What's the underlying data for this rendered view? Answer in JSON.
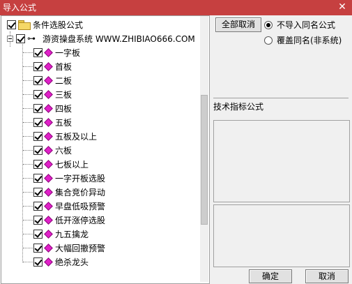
{
  "window": {
    "title": "导入公式",
    "close_glyph": "✕"
  },
  "tree": {
    "root": {
      "label": "条件选股公式",
      "checked": true
    },
    "group": {
      "label": "游资操盘系统 WWW.ZHIBIAO666.COM",
      "checked": true
    },
    "items": [
      {
        "label": "一字板",
        "checked": true
      },
      {
        "label": "首板",
        "checked": true
      },
      {
        "label": "二板",
        "checked": true
      },
      {
        "label": "三板",
        "checked": true
      },
      {
        "label": "四板",
        "checked": true
      },
      {
        "label": "五板",
        "checked": true
      },
      {
        "label": "五板及以上",
        "checked": true
      },
      {
        "label": "六板",
        "checked": true
      },
      {
        "label": "七板以上",
        "checked": true
      },
      {
        "label": "一字开板选股",
        "checked": true
      },
      {
        "label": "集合竞价异动",
        "checked": true
      },
      {
        "label": "早盘低吸预警",
        "checked": true
      },
      {
        "label": "低开涨停选股",
        "checked": true
      },
      {
        "label": "九五擒龙",
        "checked": true
      },
      {
        "label": "大幅回撤预警",
        "checked": true
      },
      {
        "label": "绝杀龙头",
        "checked": true
      }
    ]
  },
  "actions": {
    "cancel_all_label": "全部取消",
    "option_no_import_label": "不导入同名公式",
    "option_overwrite_label": "覆盖同名(非系统)",
    "selected_option": "no_import"
  },
  "formula_section": {
    "label": "技术指标公式"
  },
  "footer": {
    "ok_label": "确定",
    "cancel_label": "取消"
  },
  "colors": {
    "title_bar": "#c64040",
    "gem": "#e020c8",
    "folder": "#f5d867"
  }
}
